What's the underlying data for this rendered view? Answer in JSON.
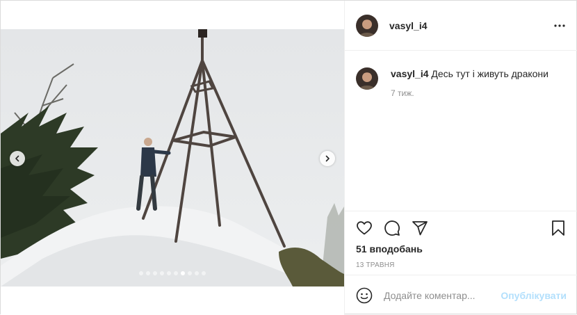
{
  "post": {
    "author": {
      "username": "vasyl_i4",
      "avatar_icon": "user-avatar"
    },
    "more_icon": "more-horizontal-icon",
    "caption": {
      "username": "vasyl_i4",
      "text": "Десь тут і живуть дракони",
      "time_ago": "7 тиж."
    },
    "carousel": {
      "total": 10,
      "active_index": 6,
      "prev_icon": "chevron-left-icon",
      "next_icon": "chevron-right-icon"
    },
    "actions": {
      "like_icon": "heart-icon",
      "comment_icon": "comment-icon",
      "share_icon": "paper-plane-icon",
      "save_icon": "bookmark-icon"
    },
    "likes": "51 вподобань",
    "date": "13 ТРАВНЯ",
    "add_comment": {
      "emoji_icon": "smiley-icon",
      "placeholder": "Додайте коментар...",
      "post_label": "Опублікувати"
    },
    "colors": {
      "text": "#262626",
      "muted": "#8e8e8e",
      "post_button_disabled": "#b2dffc",
      "border": "#dbdbdb"
    }
  }
}
